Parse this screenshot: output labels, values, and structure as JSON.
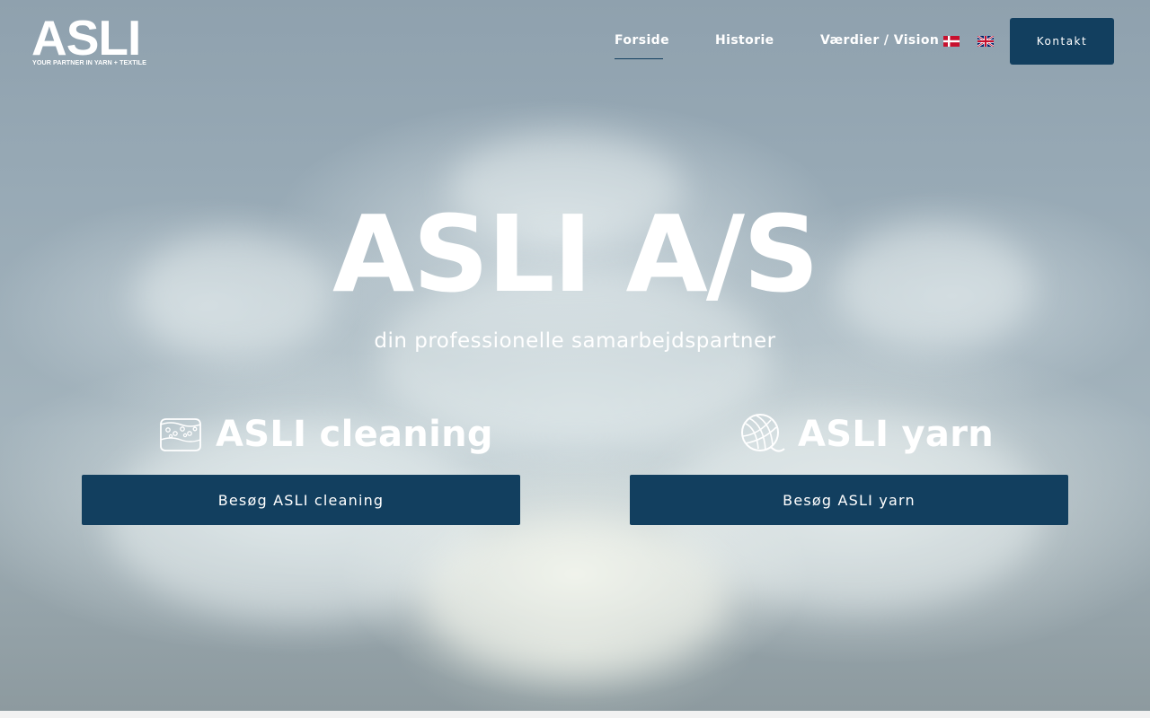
{
  "brand": {
    "name": "ASLI",
    "tagline": "YOUR PARTNER IN YARN + TEXTILE"
  },
  "nav": {
    "items": [
      {
        "label": "Forside",
        "active": true
      },
      {
        "label": "Historie",
        "active": false
      },
      {
        "label": "Værdier / Vision",
        "active": false
      }
    ],
    "languages": [
      {
        "name": "Dansk",
        "icon": "danish-flag-icon"
      },
      {
        "name": "English",
        "icon": "uk-flag-icon"
      }
    ],
    "contact_label": "Kontakt"
  },
  "hero": {
    "title": "ASLI A/S",
    "subtitle": "din professionelle samarbejdspartner"
  },
  "services": [
    {
      "name": "ASLI cleaning",
      "icon": "sponge-icon",
      "button_label": "Besøg ASLI cleaning"
    },
    {
      "name": "ASLI yarn",
      "icon": "yarn-ball-icon",
      "button_label": "Besøg ASLI yarn"
    }
  ],
  "colors": {
    "primary": "#123f5f",
    "text_on_hero": "#ffffff"
  }
}
